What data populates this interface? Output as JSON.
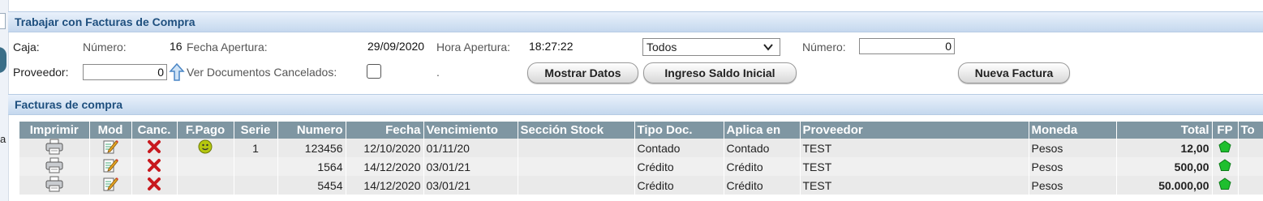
{
  "section1": {
    "title": "Trabajar con Facturas de Compra"
  },
  "form": {
    "caja_label": "Caja:",
    "numero_label": "Número:",
    "numero_value": "16",
    "fecha_apertura_label": "Fecha Apertura:",
    "fecha_apertura_value": "29/09/2020",
    "hora_apertura_label": "Hora Apertura:",
    "hora_apertura_value": "18:27:22",
    "filter_select_value": "Todos",
    "numero2_label": "Número:",
    "numero2_value": "0",
    "proveedor_label": "Proveedor:",
    "proveedor_value": "0",
    "ver_cancelados_label": "Ver Documentos Cancelados:",
    "dot": "."
  },
  "buttons": {
    "mostrar": "Mostrar Datos",
    "ingreso": "Ingreso Saldo Inicial",
    "nueva": "Nueva Factura"
  },
  "section2": {
    "title": "Facturas de compra"
  },
  "sidebar": {
    "fragment": "a"
  },
  "table": {
    "headers": [
      "Imprimir",
      "Mod",
      "Canc.",
      "F.Pago",
      "Serie",
      "Numero",
      "Fecha",
      "Vencimiento",
      "Sección Stock",
      "Tipo Doc.",
      "Aplica en",
      "Proveedor",
      "Moneda",
      "Total",
      "FP",
      "To"
    ],
    "rows": [
      {
        "serie": "1",
        "numero": "123456",
        "fecha": "12/10/2020",
        "venc": "01/11/20",
        "seccion": "",
        "tipo": "Contado",
        "aplica": "Contado",
        "proveedor": "TEST",
        "moneda": "Pesos",
        "total": "12,00",
        "fpago": true
      },
      {
        "serie": "",
        "numero": "1564",
        "fecha": "14/12/2020",
        "venc": "03/01/21",
        "seccion": "",
        "tipo": "Crédito",
        "aplica": "Crédito",
        "proveedor": "TEST",
        "moneda": "Pesos",
        "total": "500,00",
        "fpago": false
      },
      {
        "serie": "",
        "numero": "5454",
        "fecha": "14/12/2020",
        "venc": "03/01/21",
        "seccion": "",
        "tipo": "Crédito",
        "aplica": "Crédito",
        "proveedor": "TEST",
        "moneda": "Pesos",
        "total": "50.000,00",
        "fpago": false
      }
    ]
  },
  "icons": {
    "print": "printer-icon",
    "edit": "edit-icon",
    "cancel": "cancel-x-icon",
    "pago": "smiley-coin-icon",
    "fp": "green-pentagon-icon",
    "arrow": "up-arrow-icon"
  },
  "colors": {
    "header_text": "#1e4f7e",
    "table_header_bg": "#7f96a2",
    "cancel_red": "#c8191e",
    "fp_green": "#1fbf2f"
  }
}
